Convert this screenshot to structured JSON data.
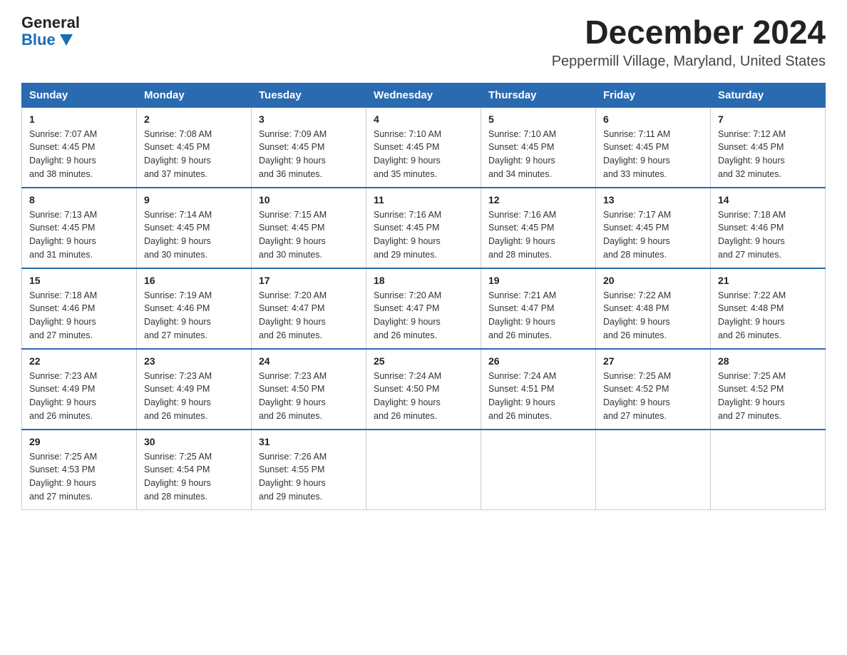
{
  "logo": {
    "general": "General",
    "blue": "Blue"
  },
  "title": "December 2024",
  "location": "Peppermill Village, Maryland, United States",
  "weekdays": [
    "Sunday",
    "Monday",
    "Tuesday",
    "Wednesday",
    "Thursday",
    "Friday",
    "Saturday"
  ],
  "weeks": [
    [
      {
        "day": "1",
        "sunrise": "7:07 AM",
        "sunset": "4:45 PM",
        "daylight": "9 hours and 38 minutes."
      },
      {
        "day": "2",
        "sunrise": "7:08 AM",
        "sunset": "4:45 PM",
        "daylight": "9 hours and 37 minutes."
      },
      {
        "day": "3",
        "sunrise": "7:09 AM",
        "sunset": "4:45 PM",
        "daylight": "9 hours and 36 minutes."
      },
      {
        "day": "4",
        "sunrise": "7:10 AM",
        "sunset": "4:45 PM",
        "daylight": "9 hours and 35 minutes."
      },
      {
        "day": "5",
        "sunrise": "7:10 AM",
        "sunset": "4:45 PM",
        "daylight": "9 hours and 34 minutes."
      },
      {
        "day": "6",
        "sunrise": "7:11 AM",
        "sunset": "4:45 PM",
        "daylight": "9 hours and 33 minutes."
      },
      {
        "day": "7",
        "sunrise": "7:12 AM",
        "sunset": "4:45 PM",
        "daylight": "9 hours and 32 minutes."
      }
    ],
    [
      {
        "day": "8",
        "sunrise": "7:13 AM",
        "sunset": "4:45 PM",
        "daylight": "9 hours and 31 minutes."
      },
      {
        "day": "9",
        "sunrise": "7:14 AM",
        "sunset": "4:45 PM",
        "daylight": "9 hours and 30 minutes."
      },
      {
        "day": "10",
        "sunrise": "7:15 AM",
        "sunset": "4:45 PM",
        "daylight": "9 hours and 30 minutes."
      },
      {
        "day": "11",
        "sunrise": "7:16 AM",
        "sunset": "4:45 PM",
        "daylight": "9 hours and 29 minutes."
      },
      {
        "day": "12",
        "sunrise": "7:16 AM",
        "sunset": "4:45 PM",
        "daylight": "9 hours and 28 minutes."
      },
      {
        "day": "13",
        "sunrise": "7:17 AM",
        "sunset": "4:45 PM",
        "daylight": "9 hours and 28 minutes."
      },
      {
        "day": "14",
        "sunrise": "7:18 AM",
        "sunset": "4:46 PM",
        "daylight": "9 hours and 27 minutes."
      }
    ],
    [
      {
        "day": "15",
        "sunrise": "7:18 AM",
        "sunset": "4:46 PM",
        "daylight": "9 hours and 27 minutes."
      },
      {
        "day": "16",
        "sunrise": "7:19 AM",
        "sunset": "4:46 PM",
        "daylight": "9 hours and 27 minutes."
      },
      {
        "day": "17",
        "sunrise": "7:20 AM",
        "sunset": "4:47 PM",
        "daylight": "9 hours and 26 minutes."
      },
      {
        "day": "18",
        "sunrise": "7:20 AM",
        "sunset": "4:47 PM",
        "daylight": "9 hours and 26 minutes."
      },
      {
        "day": "19",
        "sunrise": "7:21 AM",
        "sunset": "4:47 PM",
        "daylight": "9 hours and 26 minutes."
      },
      {
        "day": "20",
        "sunrise": "7:22 AM",
        "sunset": "4:48 PM",
        "daylight": "9 hours and 26 minutes."
      },
      {
        "day": "21",
        "sunrise": "7:22 AM",
        "sunset": "4:48 PM",
        "daylight": "9 hours and 26 minutes."
      }
    ],
    [
      {
        "day": "22",
        "sunrise": "7:23 AM",
        "sunset": "4:49 PM",
        "daylight": "9 hours and 26 minutes."
      },
      {
        "day": "23",
        "sunrise": "7:23 AM",
        "sunset": "4:49 PM",
        "daylight": "9 hours and 26 minutes."
      },
      {
        "day": "24",
        "sunrise": "7:23 AM",
        "sunset": "4:50 PM",
        "daylight": "9 hours and 26 minutes."
      },
      {
        "day": "25",
        "sunrise": "7:24 AM",
        "sunset": "4:50 PM",
        "daylight": "9 hours and 26 minutes."
      },
      {
        "day": "26",
        "sunrise": "7:24 AM",
        "sunset": "4:51 PM",
        "daylight": "9 hours and 26 minutes."
      },
      {
        "day": "27",
        "sunrise": "7:25 AM",
        "sunset": "4:52 PM",
        "daylight": "9 hours and 27 minutes."
      },
      {
        "day": "28",
        "sunrise": "7:25 AM",
        "sunset": "4:52 PM",
        "daylight": "9 hours and 27 minutes."
      }
    ],
    [
      {
        "day": "29",
        "sunrise": "7:25 AM",
        "sunset": "4:53 PM",
        "daylight": "9 hours and 27 minutes."
      },
      {
        "day": "30",
        "sunrise": "7:25 AM",
        "sunset": "4:54 PM",
        "daylight": "9 hours and 28 minutes."
      },
      {
        "day": "31",
        "sunrise": "7:26 AM",
        "sunset": "4:55 PM",
        "daylight": "9 hours and 29 minutes."
      },
      null,
      null,
      null,
      null
    ]
  ]
}
